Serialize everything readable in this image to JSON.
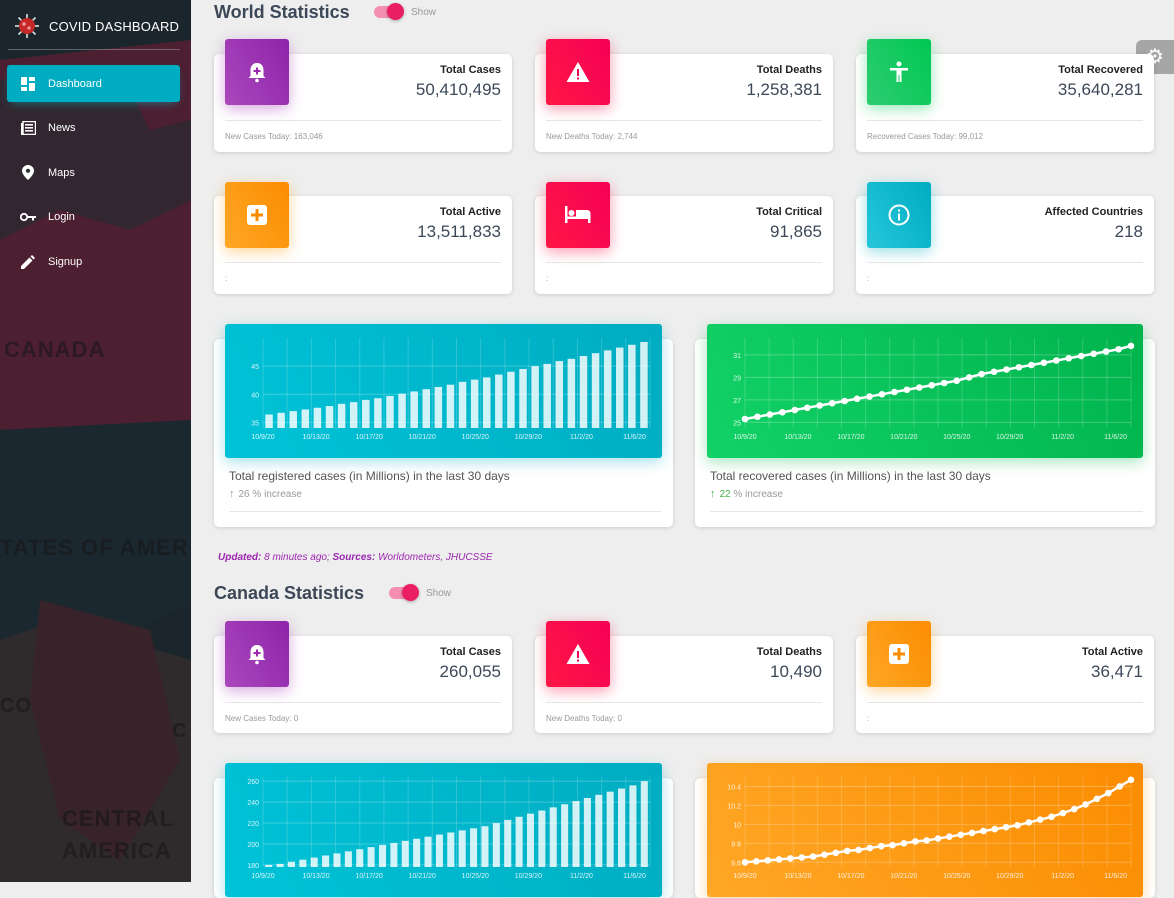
{
  "sidebar": {
    "brand": "COVID DASHBOARD",
    "items": [
      {
        "label": "Dashboard",
        "icon": "dashboard-icon",
        "active": true
      },
      {
        "label": "News",
        "icon": "news-icon",
        "active": false
      },
      {
        "label": "Maps",
        "icon": "map-pin-icon",
        "active": false
      },
      {
        "label": "Login",
        "icon": "key-icon",
        "active": false
      },
      {
        "label": "Signup",
        "icon": "pencil-icon",
        "active": false
      }
    ],
    "map_labels": [
      "CANADA",
      "TATES OF AMER",
      "CO",
      "C",
      "CENTRAL",
      "AMERICA"
    ]
  },
  "world": {
    "title": "World Statistics",
    "toggle_label": "Show",
    "cards": [
      {
        "label": "Total Cases",
        "value": "50,410,495",
        "footer_label": "New Cases Today:",
        "footer_value": "163,046",
        "color": "purple",
        "icon": "hospital-bell-icon"
      },
      {
        "label": "Total Deaths",
        "value": "1,258,381",
        "footer_label": "New Deaths Today:",
        "footer_value": "2,744",
        "color": "red",
        "icon": "warning-icon"
      },
      {
        "label": "Total Recovered",
        "value": "35,640,281",
        "footer_label": "Recovered Cases Today:",
        "footer_value": "99,012",
        "color": "green",
        "icon": "accessibility-icon"
      },
      {
        "label": "Total Active",
        "value": "13,511,833",
        "footer_label": ":",
        "footer_value": "",
        "color": "orange",
        "icon": "medical-plus-icon"
      },
      {
        "label": "Total Critical",
        "value": "91,865",
        "footer_label": ":",
        "footer_value": "",
        "color": "red",
        "icon": "hospital-bed-icon"
      },
      {
        "label": "Affected Countries",
        "value": "218",
        "footer_label": ":",
        "footer_value": "",
        "color": "cyan",
        "icon": "info-icon"
      }
    ],
    "chart_captions": [
      {
        "caption": "Total registered cases (in Millions) in the last 30 days",
        "delta": "26",
        "delta_text": "% increase",
        "delta_color": "#999999"
      },
      {
        "caption": "Total recovered cases (in Millions) in the last 30 days",
        "delta": "22",
        "delta_text": "% increase",
        "delta_color": "#4caf50"
      }
    ]
  },
  "updated": {
    "prefix": "Updated:",
    "time": "8 minutes ago;",
    "sources_label": "Sources:",
    "sources": "Worldometers, JHUCSSE"
  },
  "canada": {
    "title": "Canada Statistics",
    "toggle_label": "Show",
    "cards": [
      {
        "label": "Total Cases",
        "value": "260,055",
        "footer_label": "New Cases Today:",
        "footer_value": "0",
        "color": "purple",
        "icon": "hospital-bell-icon"
      },
      {
        "label": "Total Deaths",
        "value": "10,490",
        "footer_label": "New Deaths Today:",
        "footer_value": "0",
        "color": "red",
        "icon": "warning-icon"
      },
      {
        "label": "Total Active",
        "value": "36,471",
        "footer_label": ":",
        "footer_value": "",
        "color": "orange",
        "icon": "medical-plus-icon"
      }
    ]
  },
  "chart_data": [
    {
      "type": "bar",
      "x_ticks": [
        "10/9/20",
        "10/13/20",
        "10/17/20",
        "10/21/20",
        "10/25/20",
        "10/29/20",
        "11/2/20",
        "11/6/20"
      ],
      "y_ticks": [
        35,
        40,
        45
      ],
      "ylim": [
        34,
        50
      ],
      "values": [
        36.4,
        36.7,
        37.0,
        37.3,
        37.6,
        37.9,
        38.3,
        38.6,
        39.0,
        39.3,
        39.7,
        40.1,
        40.5,
        40.9,
        41.3,
        41.7,
        42.2,
        42.6,
        43.0,
        43.5,
        44.0,
        44.5,
        45.0,
        45.4,
        45.9,
        46.3,
        46.8,
        47.3,
        47.8,
        48.3,
        48.8,
        49.3
      ]
    },
    {
      "type": "line",
      "x_ticks": [
        "10/9/20",
        "10/13/20",
        "10/17/20",
        "10/21/20",
        "10/25/20",
        "10/29/20",
        "11/2/20",
        "11/6/20"
      ],
      "y_ticks": [
        25,
        27,
        29,
        31
      ],
      "ylim": [
        24.5,
        32.5
      ],
      "values": [
        25.3,
        25.5,
        25.7,
        25.9,
        26.1,
        26.3,
        26.5,
        26.7,
        26.9,
        27.1,
        27.3,
        27.5,
        27.7,
        27.9,
        28.1,
        28.3,
        28.5,
        28.7,
        29.0,
        29.3,
        29.5,
        29.7,
        29.9,
        30.1,
        30.3,
        30.5,
        30.7,
        30.9,
        31.1,
        31.3,
        31.5,
        31.8
      ]
    },
    {
      "type": "bar",
      "x_ticks": [
        "10/9/20",
        "10/13/20",
        "10/17/20",
        "10/21/20",
        "10/25/20",
        "10/29/20",
        "11/2/20",
        "11/6/20"
      ],
      "y_ticks": [
        180,
        200,
        220,
        240,
        260
      ],
      "ylim": [
        178,
        264
      ],
      "values": [
        180,
        181,
        183,
        185,
        187,
        189,
        191,
        193,
        195,
        197,
        199,
        201,
        203,
        205,
        207,
        209,
        211,
        213,
        215,
        217,
        220,
        223,
        226,
        229,
        232,
        235,
        238,
        241,
        244,
        247,
        250,
        253,
        256,
        260
      ]
    },
    {
      "type": "line",
      "x_ticks": [
        "10/9/20",
        "10/13/20",
        "10/17/20",
        "10/21/20",
        "10/25/20",
        "10/29/20",
        "11/2/20",
        "11/6/20"
      ],
      "y_ticks": [
        9.6,
        9.8,
        10,
        10.2,
        10.4
      ],
      "ylim": [
        9.55,
        10.5
      ],
      "values": [
        9.6,
        9.61,
        9.62,
        9.63,
        9.64,
        9.65,
        9.66,
        9.68,
        9.7,
        9.72,
        9.73,
        9.75,
        9.77,
        9.78,
        9.8,
        9.82,
        9.83,
        9.85,
        9.87,
        9.89,
        9.91,
        9.93,
        9.95,
        9.97,
        9.99,
        10.02,
        10.05,
        10.08,
        10.12,
        10.16,
        10.21,
        10.27,
        10.33,
        10.4,
        10.47
      ]
    }
  ]
}
